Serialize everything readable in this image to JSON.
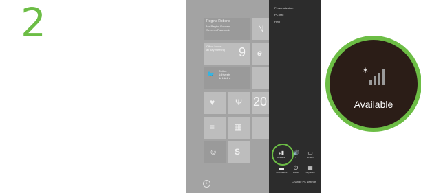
{
  "step_number": "2",
  "start_screen": {
    "tiles": {
      "contact_name": "Regina Roberts",
      "contact_sub": "Ms Regina Roberts\nSeen on Facebook",
      "calendar_day": "9",
      "calendar_text": "Office hours\nall day meeting",
      "twitter_text": "Twitter\n14 tweets\n★★★★★",
      "clock_value": "20"
    }
  },
  "charms_panel": {
    "menu": [
      "Personalization",
      "PC Info",
      "Help"
    ],
    "quick_settings": [
      {
        "icon": "network-signal-icon",
        "label": "Available"
      },
      {
        "icon": "volume-icon",
        "label": "4"
      },
      {
        "icon": "brightness-icon",
        "label": "Screen"
      },
      {
        "icon": "notifications-icon",
        "label": "Notifications"
      },
      {
        "icon": "power-icon",
        "label": "Power"
      },
      {
        "icon": "keyboard-icon",
        "label": "Keyboard"
      }
    ],
    "change_link": "Change PC settings"
  },
  "zoom_callout": {
    "icon": "network-signal-icon",
    "label": "Available"
  },
  "colors": {
    "accent_green": "#6cbd45",
    "panel_bg": "#2c2c2c",
    "callout_bg": "#2b1d17"
  }
}
